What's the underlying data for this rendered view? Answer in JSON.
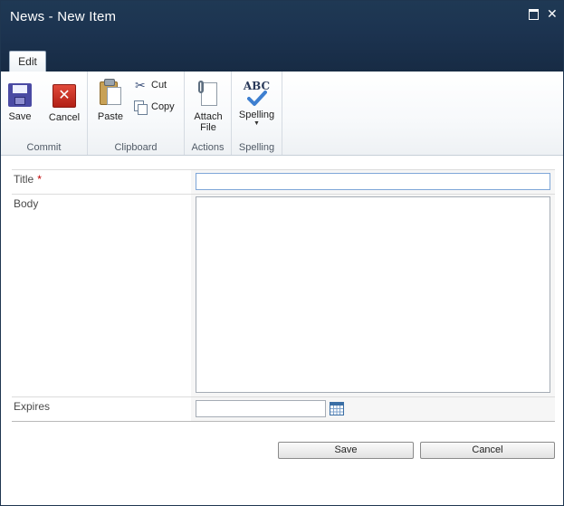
{
  "window": {
    "title": "News - New Item",
    "maximize_icon": "maximize-icon",
    "close_icon": "close-icon"
  },
  "ribbon": {
    "tabs": [
      {
        "label": "Edit",
        "selected": true
      }
    ],
    "groups": {
      "commit": {
        "label": "Commit",
        "save": {
          "label": "Save",
          "icon": "save-icon"
        },
        "cancel": {
          "label": "Cancel",
          "icon": "cancel-icon"
        }
      },
      "clipboard": {
        "label": "Clipboard",
        "paste": {
          "label": "Paste",
          "icon": "paste-icon"
        },
        "cut": {
          "label": "Cut",
          "icon": "scissors-icon"
        },
        "copy": {
          "label": "Copy",
          "icon": "copy-icon"
        }
      },
      "actions": {
        "label": "Actions",
        "attach_file_line1": "Attach",
        "attach_file_line2": "File",
        "attach_icon": "paperclip-icon"
      },
      "spelling": {
        "label": "Spelling",
        "spelling_button": "Spelling",
        "abc_text": "ABC",
        "icon": "spellcheck-icon"
      }
    }
  },
  "form": {
    "fields": {
      "title": {
        "label": "Title",
        "required_marker": "*",
        "value": ""
      },
      "body": {
        "label": "Body",
        "value": ""
      },
      "expires": {
        "label": "Expires",
        "value": "",
        "icon": "calendar-icon"
      }
    },
    "buttons": {
      "save": "Save",
      "cancel": "Cancel"
    }
  },
  "colors": {
    "titlebar": "#1c3350",
    "required": "#bf0000",
    "input_focus_border": "#7ea6d8"
  }
}
